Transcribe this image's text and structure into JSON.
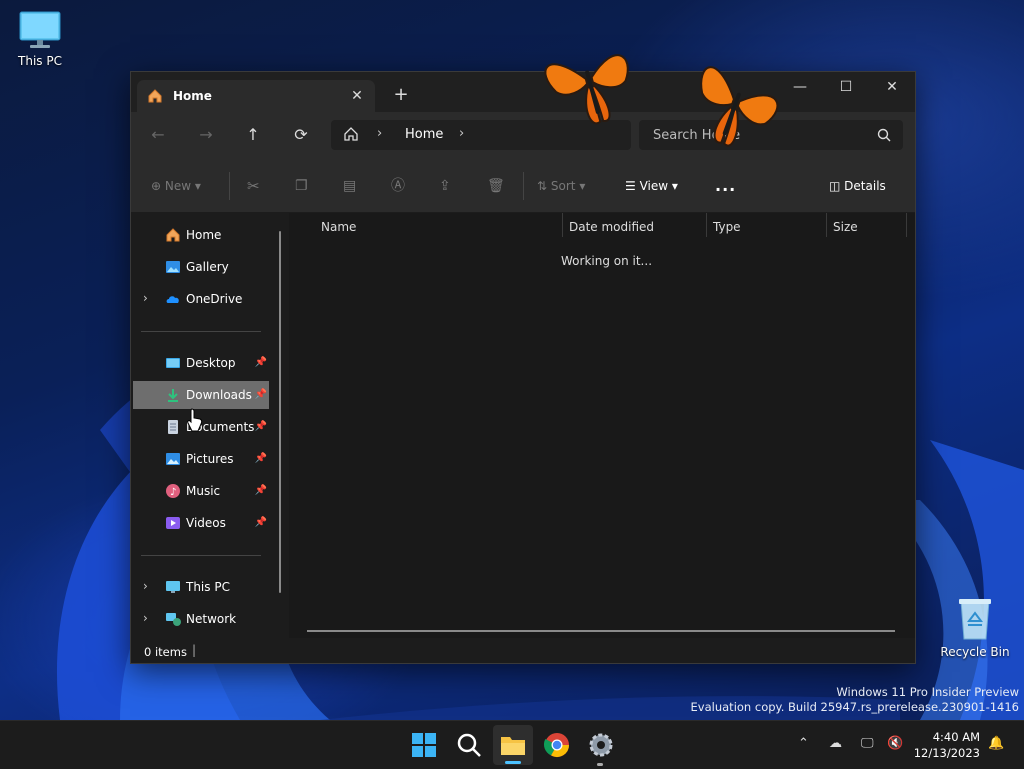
{
  "desktop": {
    "icons": [
      {
        "label": "This PC",
        "icon": "monitor-icon"
      },
      {
        "label": "Recycle Bin",
        "icon": "recycle-bin-icon"
      }
    ],
    "watermark": {
      "line1": "Windows 11 Pro Insider Preview",
      "line2": "Evaluation copy. Build 25947.rs_prerelease.230901-1416"
    }
  },
  "explorer": {
    "tab": {
      "title": "Home",
      "icon": "home-icon"
    },
    "window_controls": [
      "minimize",
      "maximize",
      "close"
    ],
    "address": {
      "crumbs": [
        "Home"
      ]
    },
    "search": {
      "placeholder": "Search Home"
    },
    "toolbar": {
      "new_label": "New",
      "sort_label": "Sort",
      "view_label": "View",
      "details_label": "Details",
      "more": "..."
    },
    "sidebar": {
      "top": [
        {
          "label": "Home",
          "icon": "home-icon"
        },
        {
          "label": "Gallery",
          "icon": "gallery-icon"
        },
        {
          "label": "OneDrive",
          "icon": "cloud-icon",
          "expandable": true
        }
      ],
      "pinned": [
        {
          "label": "Desktop",
          "icon": "desktop-folder-icon"
        },
        {
          "label": "Downloads",
          "icon": "download-icon",
          "selected": true
        },
        {
          "label": "Documents",
          "icon": "documents-icon"
        },
        {
          "label": "Pictures",
          "icon": "pictures-icon"
        },
        {
          "label": "Music",
          "icon": "music-icon"
        },
        {
          "label": "Videos",
          "icon": "videos-icon"
        }
      ],
      "bottom": [
        {
          "label": "This PC",
          "icon": "monitor-icon"
        },
        {
          "label": "Network",
          "icon": "network-icon"
        }
      ]
    },
    "columns": [
      "Name",
      "Date modified",
      "Type",
      "Size"
    ],
    "loading_text": "Working on it...",
    "status": {
      "items": "0 items"
    }
  },
  "taskbar": {
    "apps": [
      "start",
      "search",
      "file-explorer",
      "chrome",
      "settings"
    ],
    "clock": {
      "time": "4:40 AM",
      "date": "12/13/2023"
    }
  },
  "colors": {
    "selected": "#6e6e6e",
    "window_bg": "#191919",
    "accent": "#0078d4"
  }
}
